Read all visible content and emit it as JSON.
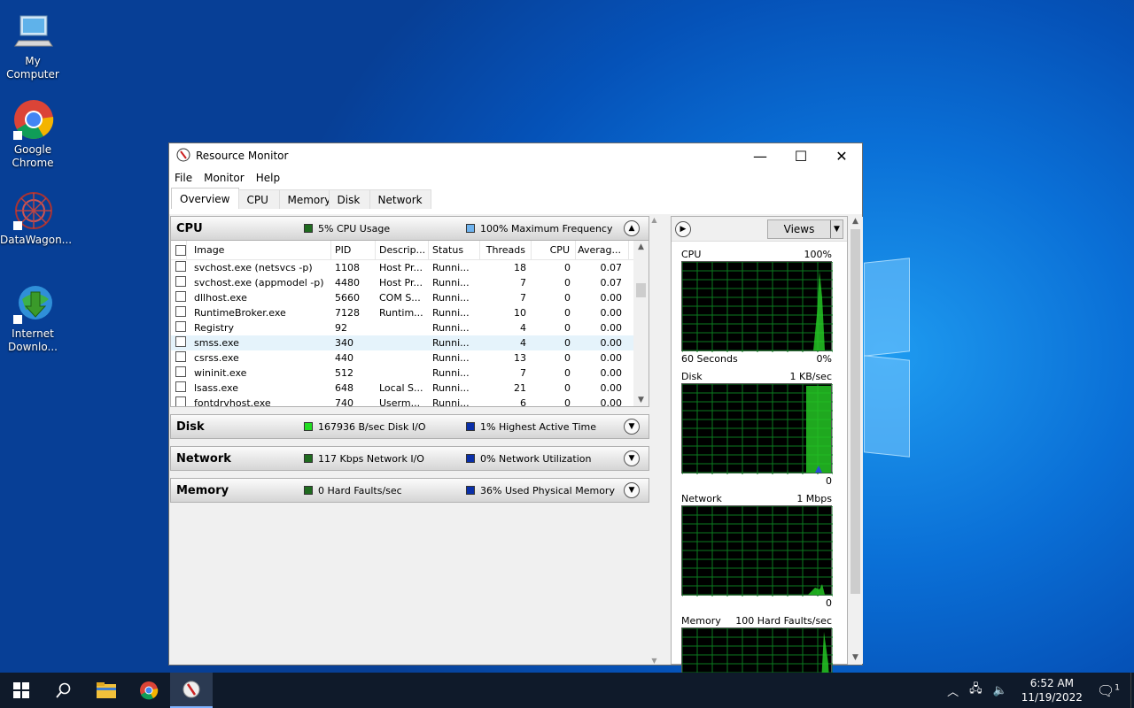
{
  "desktop": {
    "icons": [
      {
        "label_1": "My",
        "label_2": "Computer"
      },
      {
        "label_1": "Google",
        "label_2": "Chrome"
      },
      {
        "label_1": "DataWagon...",
        "label_2": ""
      },
      {
        "label_1": "Internet",
        "label_2": "Downlo..."
      }
    ]
  },
  "window": {
    "title": "Resource Monitor",
    "minimize": "—",
    "maximize": "☐",
    "close": "✕"
  },
  "menu": [
    "File",
    "Monitor",
    "Help"
  ],
  "tabs": [
    "Overview",
    "CPU",
    "Memory",
    "Disk",
    "Network"
  ],
  "sections": {
    "cpu": {
      "title": "CPU",
      "metric1": "5% CPU Usage",
      "metric2": "100% Maximum Frequency",
      "color1": "#1f6b1f",
      "color2": "#6fb3ee"
    },
    "disk": {
      "title": "Disk",
      "metric1": "167936 B/sec Disk I/O",
      "metric2": "1% Highest Active Time",
      "color1": "#22dd22",
      "color2": "#0a2fa8"
    },
    "network": {
      "title": "Network",
      "metric1": "117 Kbps Network I/O",
      "metric2": "0% Network Utilization",
      "color1": "#1f6b1f",
      "color2": "#0a2fa8"
    },
    "memory": {
      "title": "Memory",
      "metric1": "0 Hard Faults/sec",
      "metric2": "36% Used Physical Memory",
      "color1": "#1f6b1f",
      "color2": "#0a2fa8"
    }
  },
  "cpu_table": {
    "headers": [
      "Image",
      "PID",
      "Descrip...",
      "Status",
      "Threads",
      "CPU",
      "Averag..."
    ],
    "rows": [
      [
        "svchost.exe (netsvcs -p)",
        "1108",
        "Host Pr...",
        "Runni...",
        "18",
        "0",
        "0.07"
      ],
      [
        "svchost.exe (appmodel -p)",
        "4480",
        "Host Pr...",
        "Runni...",
        "7",
        "0",
        "0.07"
      ],
      [
        "dllhost.exe",
        "5660",
        "COM S...",
        "Runni...",
        "7",
        "0",
        "0.00"
      ],
      [
        "RuntimeBroker.exe",
        "7128",
        "Runtim...",
        "Runni...",
        "10",
        "0",
        "0.00"
      ],
      [
        "Registry",
        "92",
        "",
        "Runni...",
        "4",
        "0",
        "0.00"
      ],
      [
        "smss.exe",
        "340",
        "",
        "Runni...",
        "4",
        "0",
        "0.00"
      ],
      [
        "csrss.exe",
        "440",
        "",
        "Runni...",
        "13",
        "0",
        "0.00"
      ],
      [
        "wininit.exe",
        "512",
        "",
        "Runni...",
        "7",
        "0",
        "0.00"
      ],
      [
        "lsass.exe",
        "648",
        "Local S...",
        "Runni...",
        "21",
        "0",
        "0.00"
      ],
      [
        "fontdrvhost.exe",
        "740",
        "Userm...",
        "Runni...",
        "6",
        "0",
        "0.00"
      ]
    ]
  },
  "right_panel": {
    "views": "Views",
    "graphs": [
      {
        "name": "CPU",
        "top_value": "100%",
        "bottom_left": "60 Seconds",
        "bottom_right": "0%"
      },
      {
        "name": "Disk",
        "top_value": "1 KB/sec",
        "bottom_left": "",
        "bottom_right": "0"
      },
      {
        "name": "Network",
        "top_value": "1 Mbps",
        "bottom_left": "",
        "bottom_right": "0"
      },
      {
        "name": "Memory",
        "top_value": "100 Hard Faults/sec",
        "bottom_left": "",
        "bottom_right": ""
      }
    ]
  },
  "taskbar": {
    "time": "6:52 AM",
    "date": "11/19/2022",
    "notification_count": "1"
  }
}
